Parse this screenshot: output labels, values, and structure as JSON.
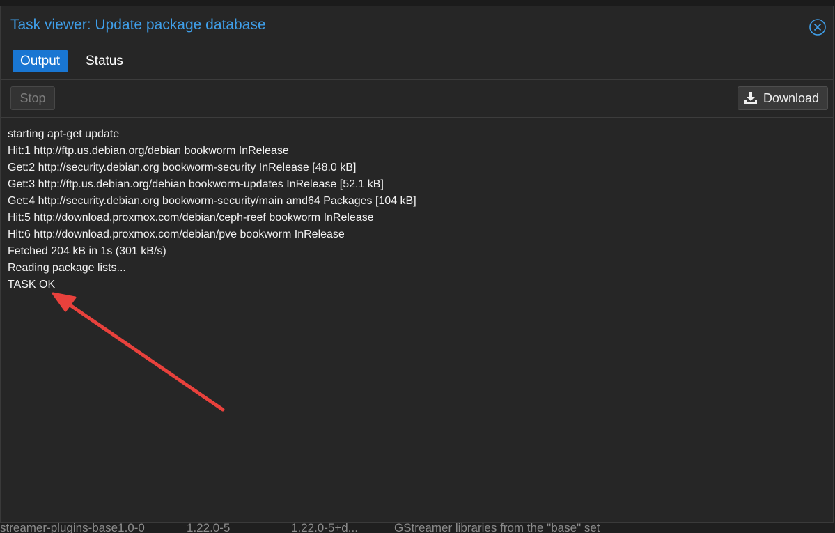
{
  "backdrop": {
    "row_cells": [
      "streamer-plugins-base1.0-0",
      "1.22.0-5",
      "1.22.0-5+d...",
      "GStreamer libraries from the \"base\" set"
    ]
  },
  "window": {
    "title": "Task viewer: Update package database",
    "close_icon": "close-circle-icon"
  },
  "tabs": [
    {
      "label": "Output",
      "active": true
    },
    {
      "label": "Status",
      "active": false
    }
  ],
  "toolbar": {
    "stop_label": "Stop",
    "download_label": "Download",
    "download_icon": "download-icon"
  },
  "log": {
    "lines": [
      "starting apt-get update",
      "Hit:1 http://ftp.us.debian.org/debian bookworm InRelease",
      "Get:2 http://security.debian.org bookworm-security InRelease [48.0 kB]",
      "Get:3 http://ftp.us.debian.org/debian bookworm-updates InRelease [52.1 kB]",
      "Get:4 http://security.debian.org bookworm-security/main amd64 Packages [104 kB]",
      "Hit:5 http://download.proxmox.com/debian/ceph-reef bookworm InRelease",
      "Hit:6 http://download.proxmox.com/debian/pve bookworm InRelease",
      "Fetched 204 kB in 1s (301 kB/s)",
      "Reading package lists...",
      "TASK OK"
    ]
  },
  "colors": {
    "title": "#3f9ee8",
    "active_tab": "#1976d2",
    "annotation_arrow": "#e8413c"
  }
}
